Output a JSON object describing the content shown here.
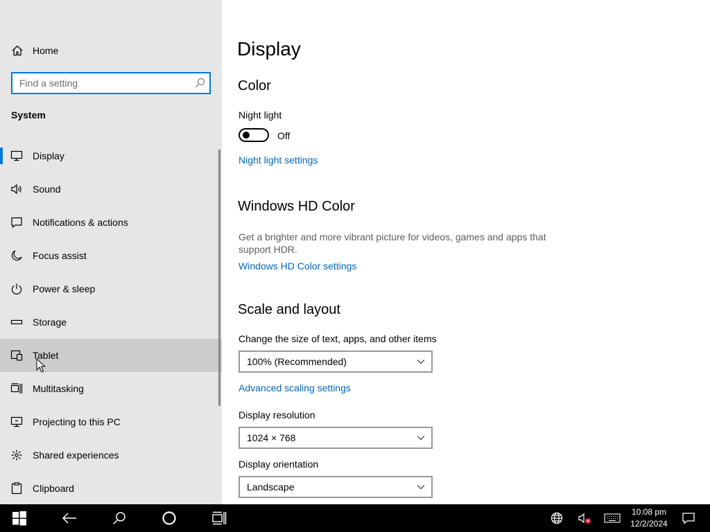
{
  "sidebar": {
    "home_label": "Home",
    "search_placeholder": "Find a setting",
    "section_title": "System",
    "items": [
      {
        "label": "Display",
        "icon": "monitor-icon"
      },
      {
        "label": "Sound",
        "icon": "speaker-icon"
      },
      {
        "label": "Notifications & actions",
        "icon": "notification-icon"
      },
      {
        "label": "Focus assist",
        "icon": "moon-icon"
      },
      {
        "label": "Power & sleep",
        "icon": "power-icon"
      },
      {
        "label": "Storage",
        "icon": "storage-icon"
      },
      {
        "label": "Tablet",
        "icon": "tablet-icon"
      },
      {
        "label": "Multitasking",
        "icon": "multitasking-icon"
      },
      {
        "label": "Projecting to this PC",
        "icon": "projecting-icon"
      },
      {
        "label": "Shared experiences",
        "icon": "share-icon"
      },
      {
        "label": "Clipboard",
        "icon": "clipboard-icon"
      }
    ],
    "selected_item": "Display",
    "hovered_item": "Tablet"
  },
  "main": {
    "page_title": "Display",
    "color_section": {
      "title": "Color",
      "night_light_label": "Night light",
      "night_light_state": "Off",
      "night_light_link": "Night light settings"
    },
    "hd_color_section": {
      "title": "Windows HD Color",
      "description": "Get a brighter and more vibrant picture for videos, games and apps that support HDR.",
      "link": "Windows HD Color settings"
    },
    "scale_section": {
      "title": "Scale and layout",
      "scale_label": "Change the size of text, apps, and other items",
      "scale_value": "100% (Recommended)",
      "advanced_link": "Advanced scaling settings",
      "resolution_label": "Display resolution",
      "resolution_value": "1024 × 768",
      "orientation_label": "Display orientation",
      "orientation_value": "Landscape"
    }
  },
  "taskbar": {
    "time": "10:08 pm",
    "date": "12/2/2024",
    "icons": [
      "windows-start-icon",
      "back-icon",
      "search-icon",
      "cortana-icon",
      "task-view-icon",
      "network-icon",
      "volume-muted-icon",
      "keyboard-icon",
      "action-center-icon"
    ]
  },
  "colors": {
    "accent": "#0078d7",
    "link": "#0067b8",
    "sidebar_bg": "#e6e6e6",
    "taskbar_bg": "#000000"
  }
}
